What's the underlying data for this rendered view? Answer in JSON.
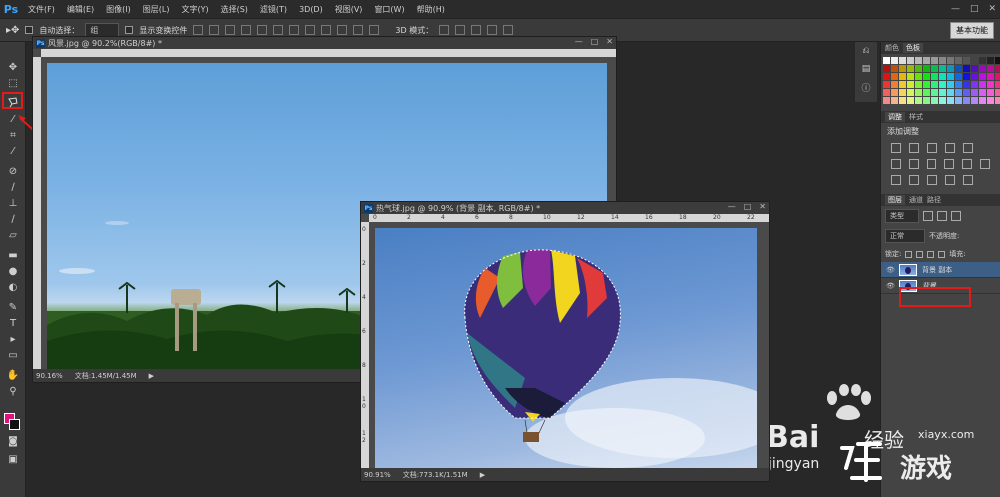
{
  "app": {
    "logo": "Ps"
  },
  "menu": [
    "文件(F)",
    "编辑(E)",
    "图像(I)",
    "图层(L)",
    "文字(Y)",
    "选择(S)",
    "滤镜(T)",
    "3D(D)",
    "视图(V)",
    "窗口(W)",
    "帮助(H)"
  ],
  "options_bar": {
    "auto_select_label": "自动选择：",
    "auto_select_value": "组",
    "show_transform_label": "显示变换控件",
    "mode_3d_label": "3D 模式：",
    "workspace": "基本功能"
  },
  "doc1": {
    "title": "风景.jpg @ 90.2%(RGB/8#) *",
    "zoom": "90.16%",
    "file_info": "文档:1.45M/1.45M"
  },
  "doc2": {
    "title": "热气球.jpg @ 90.9% (背景 副本, RGB/8#) *",
    "zoom": "90.91%",
    "file_info": "文档:773.1K/1.51M",
    "ruler_h": [
      "0",
      "2",
      "4",
      "6",
      "8",
      "10",
      "12",
      "14",
      "16",
      "18",
      "20",
      "22"
    ],
    "ruler_v": [
      "0",
      "2",
      "4",
      "6",
      "8",
      "1 0",
      "1 2"
    ]
  },
  "panels": {
    "color_tabs": [
      "颜色",
      "色板"
    ],
    "adjust_tabs": [
      "调整",
      "样式"
    ],
    "adjust_label": "添加调整",
    "layers_tabs": [
      "图层",
      "通道",
      "路径"
    ],
    "kind_label": "类型",
    "blend_mode": "正常",
    "opacity_label": "不透明度:",
    "lock_label": "锁定:",
    "fill_label": "填充:",
    "layers": [
      {
        "name": "背景 副本",
        "active": true
      },
      {
        "name": "背景",
        "active": false
      }
    ]
  },
  "watermark": {
    "brand": "Bai",
    "brand_cn": "经验",
    "site": "xiayx.com",
    "url": "jingyan",
    "game": "游戏"
  },
  "colors": {
    "foreground": "#e0117f",
    "background": "#111111",
    "highlight": "#e21b1b",
    "logo": "#3aa7ff"
  }
}
